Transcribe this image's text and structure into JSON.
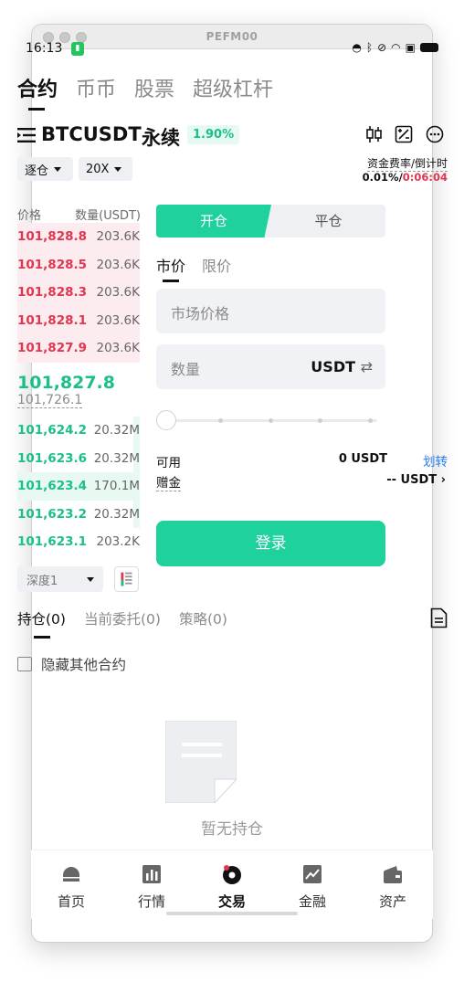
{
  "window": {
    "title": "PEFM00"
  },
  "status_bar": {
    "time": "16:13",
    "badge_icon": "app-badge-icon"
  },
  "top_tabs": [
    {
      "label": "合约",
      "active": true
    },
    {
      "label": "币币",
      "active": false
    },
    {
      "label": "股票",
      "active": false
    },
    {
      "label": "超级杠杆",
      "active": false
    }
  ],
  "pair": {
    "symbol": "BTCUSDT",
    "type": "永续",
    "change": "1.90%"
  },
  "margin_mode": "逐仓",
  "leverage": "20X",
  "funding": {
    "label": "资金费率/倒计时",
    "rate": "0.01%",
    "separator": "/",
    "countdown": "0:06:04"
  },
  "orderbook": {
    "header_price": "价格",
    "header_qty": "数量(USDT)",
    "asks": [
      {
        "price": "101,828.8",
        "qty": "203.6K",
        "depth": 1.0
      },
      {
        "price": "101,828.5",
        "qty": "203.6K",
        "depth": 1.0
      },
      {
        "price": "101,828.3",
        "qty": "203.6K",
        "depth": 1.0
      },
      {
        "price": "101,828.1",
        "qty": "203.6K",
        "depth": 1.0
      },
      {
        "price": "101,827.9",
        "qty": "203.6K",
        "depth": 1.0
      }
    ],
    "last_price": "101,827.8",
    "mark_price": "101,726.1",
    "bids": [
      {
        "price": "101,624.2",
        "qty": "20.32M",
        "depth": 0.05
      },
      {
        "price": "101,623.6",
        "qty": "20.32M",
        "depth": 0.05
      },
      {
        "price": "101,623.4",
        "qty": "170.1M",
        "depth": 1.0
      },
      {
        "price": "101,623.2",
        "qty": "20.32M",
        "depth": 0.05
      },
      {
        "price": "101,623.1",
        "qty": "203.2K",
        "depth": 0.0
      }
    ],
    "depth_select": "深度1"
  },
  "order_form": {
    "open_label": "开仓",
    "close_label": "平仓",
    "tabs": [
      {
        "label": "市价",
        "active": true
      },
      {
        "label": "限价",
        "active": false
      }
    ],
    "price_placeholder": "市场价格",
    "qty_placeholder": "数量",
    "qty_unit": "USDT",
    "slider_value": 0,
    "available_label": "可用",
    "available_value": "0 USDT",
    "transfer_label": "划转",
    "bonus_label": "赠金",
    "bonus_value": "-- USDT",
    "login_label": "登录"
  },
  "position_tabs": [
    {
      "label": "持仓(0)",
      "active": true
    },
    {
      "label": "当前委托(0)",
      "active": false
    },
    {
      "label": "策略(0)",
      "active": false
    }
  ],
  "hide_others_label": "隐藏其他合约",
  "empty_text": "暂无持仓",
  "bottom_nav": [
    {
      "label": "首页",
      "icon": "home-icon"
    },
    {
      "label": "行情",
      "icon": "market-icon"
    },
    {
      "label": "交易",
      "icon": "trade-icon",
      "active": true
    },
    {
      "label": "金融",
      "icon": "finance-icon"
    },
    {
      "label": "资产",
      "icon": "assets-icon"
    }
  ],
  "colors": {
    "accent": "#1fd19c",
    "down": "#e0364f",
    "up": "#1bbf8a",
    "link": "#2a7ff5"
  }
}
